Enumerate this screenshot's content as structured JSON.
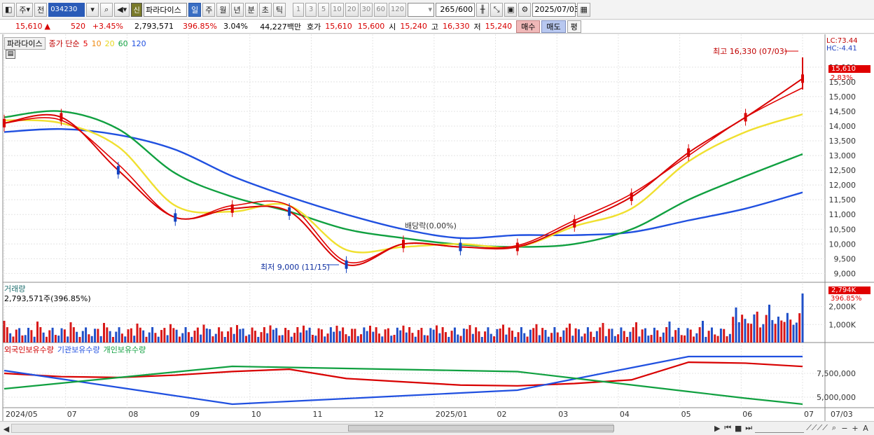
{
  "toolbar": {
    "market_label": "주",
    "prev_label": "전",
    "stock_code": "034230",
    "stock_name": "파라다이스",
    "sin_label": "신",
    "periods": [
      "일",
      "주",
      "월",
      "년",
      "분",
      "초",
      "틱"
    ],
    "active_period": "일",
    "intervals": [
      "1",
      "3",
      "5",
      "10",
      "20",
      "30",
      "60",
      "120"
    ],
    "count": "265",
    "total": "/600",
    "date": "2025/07/03"
  },
  "quote": {
    "price": "15,610",
    "arrow": "▲",
    "change": "520",
    "change_pct": "+3.45%",
    "volume": "2,793,571",
    "volume_ratio": "396.85%",
    "turnover": "3.04%",
    "amount": "44,227백만",
    "bid_label": "호가",
    "bid1": "15,610",
    "bid2": "15,600",
    "open_label": "시",
    "open": "15,240",
    "high_label": "고",
    "high": "16,330",
    "low_label": "저",
    "low": "15,240",
    "buy_label": "매수",
    "sell_label": "매도",
    "avg_label": "평"
  },
  "price_panel": {
    "legend_name": "파라다이스",
    "ma_label": "종가 단순",
    "ma_periods": [
      "5",
      "10",
      "20",
      "60",
      "120"
    ],
    "ma_colors": [
      "#e00000",
      "#f08a10",
      "#f0e030",
      "#10a040",
      "#2050e0"
    ],
    "lc": "LC:73.44",
    "hc": "HC:-4.41",
    "current_price": "15,610",
    "current_pct": "2.83%",
    "high_note": "최고 16,330 (07/03)",
    "low_note": "최저 9,000 (11/15)",
    "dividend_note": "배당락(0.00%)",
    "y_ticks": [
      "16,000",
      "15,500",
      "15,000",
      "14,500",
      "14,000",
      "13,500",
      "13,000",
      "12,500",
      "12,000",
      "11,500",
      "11,000",
      "10,500",
      "10,000",
      "9,500",
      "9,000"
    ]
  },
  "volume_panel": {
    "title": "거래량",
    "value": "2,793,571주(396.85%)",
    "current": "2,794K",
    "current_pct": "396.85%",
    "y_ticks": [
      "2,000K",
      "1,000K"
    ]
  },
  "holding_panel": {
    "series": [
      "외국인보유수량",
      "기관보유수량",
      "개인보유수량"
    ],
    "series_colors": [
      "#e00000",
      "#2050e0",
      "#10a040"
    ],
    "y_ticks": [
      "7,500,000",
      "5,000,000"
    ]
  },
  "x_axis": {
    "labels": [
      "2024/05",
      "07",
      "08",
      "09",
      "10",
      "11",
      "12",
      "2025/01",
      "02",
      "03",
      "04",
      "05",
      "06",
      "07"
    ],
    "end_label": "07/03"
  },
  "chart_data": {
    "type": "line",
    "title": "파라다이스",
    "ylim": [
      8700,
      16400
    ],
    "grid": true,
    "legend_placement": "top-left",
    "series": [
      {
        "name": "종가",
        "x": [
          "2024/05",
          "2024/06",
          "2024/07",
          "2024/08",
          "2024/09",
          "2024/10",
          "2024/11",
          "2024/12",
          "2025/01",
          "2025/02",
          "2025/03",
          "2025/04",
          "2025/05",
          "2025/06",
          "2025/07/03"
        ],
        "values": [
          14100,
          14300,
          12500,
          10900,
          11200,
          11100,
          9300,
          10000,
          9900,
          9900,
          10700,
          11600,
          13100,
          14300,
          15610
        ]
      },
      {
        "name": "5",
        "values": [
          14100,
          14200,
          12700,
          10900,
          11300,
          11300,
          9400,
          10000,
          9900,
          9950,
          10800,
          11700,
          13000,
          14300,
          15300
        ]
      },
      {
        "name": "20",
        "values": [
          14200,
          14100,
          13300,
          11300,
          11100,
          11300,
          9800,
          9900,
          10000,
          9900,
          10600,
          11200,
          12800,
          13800,
          14400
        ]
      },
      {
        "name": "60",
        "values": [
          14300,
          14500,
          13900,
          12400,
          11600,
          11100,
          10500,
          10200,
          9980,
          9900,
          10000,
          10500,
          11500,
          12300,
          13050
        ]
      },
      {
        "name": "120",
        "values": [
          13800,
          13900,
          13700,
          13200,
          12300,
          11600,
          11000,
          10500,
          10200,
          10300,
          10300,
          10400,
          10800,
          11200,
          11750
        ]
      }
    ]
  }
}
